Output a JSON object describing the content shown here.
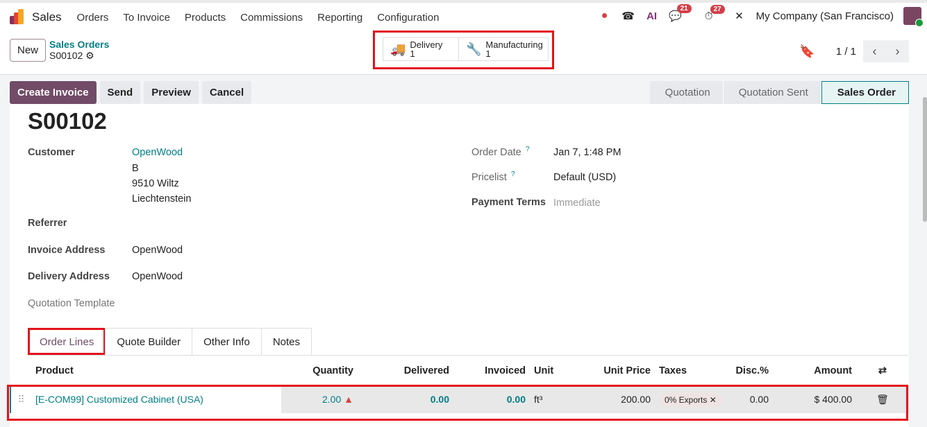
{
  "topbar": {
    "app": "Sales",
    "menu": [
      "Orders",
      "To Invoice",
      "Products",
      "Commissions",
      "Reporting",
      "Configuration"
    ],
    "messages_badge": "21",
    "activities_badge": "27",
    "company": "My Company (San Francisco)"
  },
  "control": {
    "new_label": "New",
    "breadcrumb_parent": "Sales Orders",
    "record": "S00102",
    "smart_buttons": [
      {
        "label": "Delivery",
        "count": "1"
      },
      {
        "label": "Manufacturing",
        "count": "1"
      }
    ],
    "pager": "1 / 1"
  },
  "actions": [
    "Create Invoice",
    "Send",
    "Preview",
    "Cancel"
  ],
  "statusbar": [
    "Quotation",
    "Quotation Sent",
    "Sales Order"
  ],
  "form": {
    "title": "S00102",
    "customer_label": "Customer",
    "customer": "OpenWood",
    "address": [
      "B",
      "9510 Wiltz",
      "Liechtenstein"
    ],
    "referrer_label": "Referrer",
    "invoice_address_label": "Invoice Address",
    "invoice_address": "OpenWood",
    "delivery_address_label": "Delivery Address",
    "delivery_address": "OpenWood",
    "quotation_template_label": "Quotation Template",
    "order_date_label": "Order Date",
    "order_date": "Jan 7, 1:48 PM",
    "pricelist_label": "Pricelist",
    "pricelist": "Default (USD)",
    "payment_terms_label": "Payment Terms",
    "payment_terms_placeholder": "Immediate",
    "help": "?"
  },
  "tabs": [
    "Order Lines",
    "Quote Builder",
    "Other Info",
    "Notes"
  ],
  "table": {
    "headers": [
      "Product",
      "Quantity",
      "Delivered",
      "Invoiced",
      "Unit",
      "Unit Price",
      "Taxes",
      "Disc.%",
      "Amount"
    ],
    "rows": [
      {
        "product": "[E-COM99] Customized Cabinet (USA)",
        "quantity": "2.00",
        "delivered": "0.00",
        "invoiced": "0.00",
        "unit": "ft³",
        "unit_price": "200.00",
        "tax": "0% Exports",
        "discount": "0.00",
        "amount": "$ 400.00"
      }
    ]
  },
  "colors": {
    "brand": "#714b67",
    "teal": "#017e84",
    "highlight": "#e3121b"
  }
}
